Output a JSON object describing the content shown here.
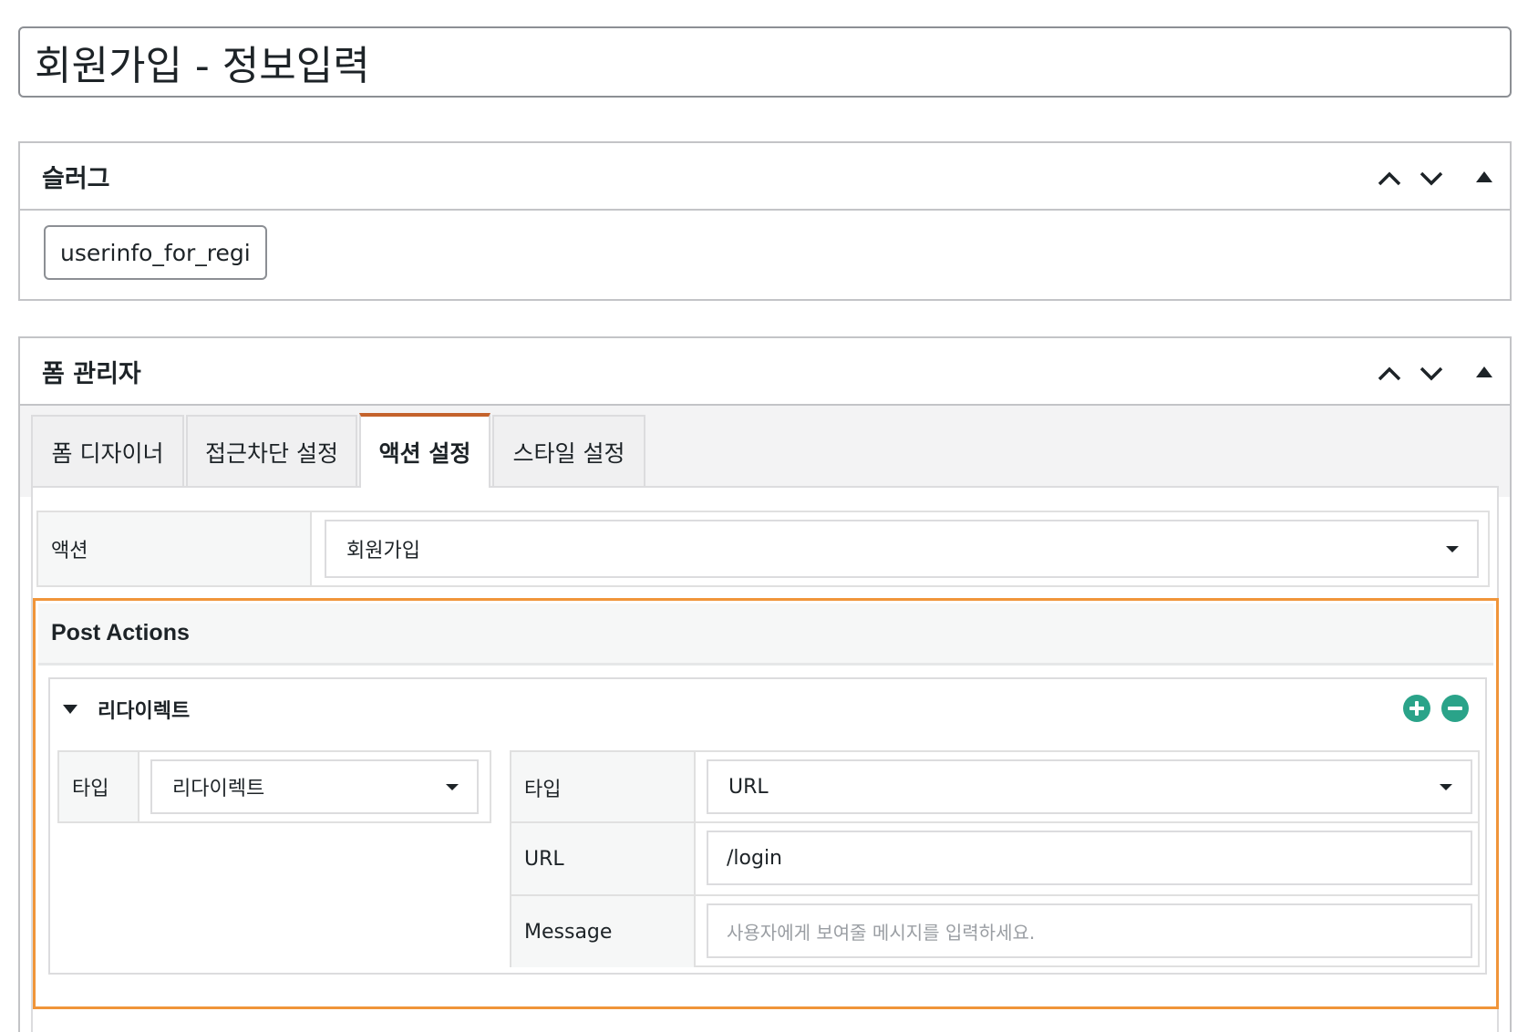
{
  "title": "회원가입 - 정보입력",
  "slug_box": {
    "heading": "슬러그",
    "value": "userinfo_for_regi",
    "move_up_icon": "chevron-up-icon",
    "move_down_icon": "chevron-down-icon",
    "toggle_icon": "triangle-up-icon"
  },
  "form_manager": {
    "heading": "폼 관리자",
    "tabs": [
      {
        "label": "폼 디자이너",
        "active": false
      },
      {
        "label": "접근차단 설정",
        "active": false
      },
      {
        "label": "액션 설정",
        "active": true
      },
      {
        "label": "스타일 설정",
        "active": false
      }
    ],
    "action_label": "액션",
    "action_value": "회원가입",
    "post_actions": {
      "heading": "Post Actions",
      "item_title": "리다이렉트",
      "add_icon": "plus-circle-icon",
      "remove_icon": "minus-circle-icon",
      "left": {
        "type_label": "타입",
        "type_value": "리다이렉트"
      },
      "right": {
        "type_label": "타입",
        "type_value": "URL",
        "url_label": "URL",
        "url_value": "/login",
        "message_label": "Message",
        "message_placeholder": "사용자에게 보여줄 메시지를 입력하세요."
      }
    }
  },
  "colors": {
    "active_tab": "#c4622b",
    "highlight_border": "#f0953a",
    "action_button": "#2aa389"
  }
}
